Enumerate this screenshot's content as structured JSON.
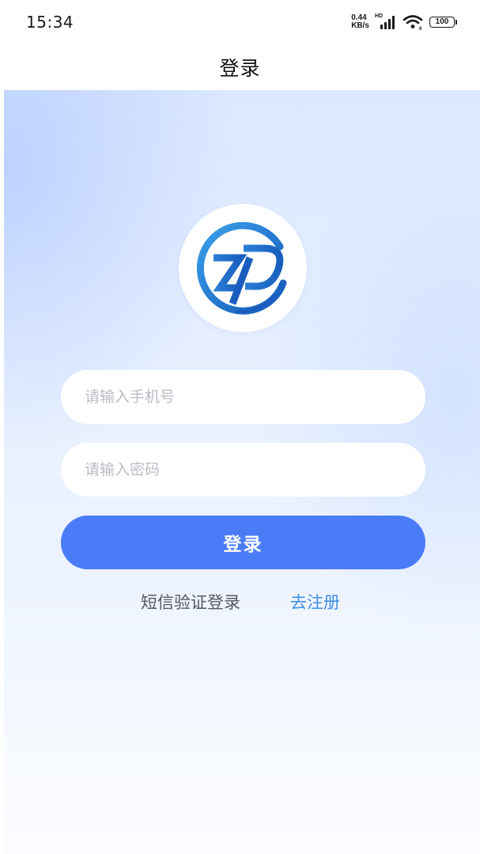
{
  "status_bar": {
    "time": "15:34",
    "net_speed_value": "0.44",
    "net_speed_unit": "KB/s",
    "network_label": "HD",
    "battery": "100"
  },
  "nav": {
    "title": "登录"
  },
  "logo": {
    "icon": "zp-logo-icon",
    "colors": {
      "primary": "#1f6fcf",
      "secondary": "#3b9be8"
    }
  },
  "form": {
    "phone_placeholder": "请输入手机号",
    "phone_value": "",
    "password_placeholder": "请输入密码",
    "password_value": "",
    "login_label": "登录"
  },
  "links": {
    "sms_login": "短信验证登录",
    "register": "去注册"
  },
  "colors": {
    "accent": "#4b7cf8",
    "link": "#3f8fe4",
    "background_top": "#dce8ff",
    "background_bottom": "#fafcff"
  }
}
